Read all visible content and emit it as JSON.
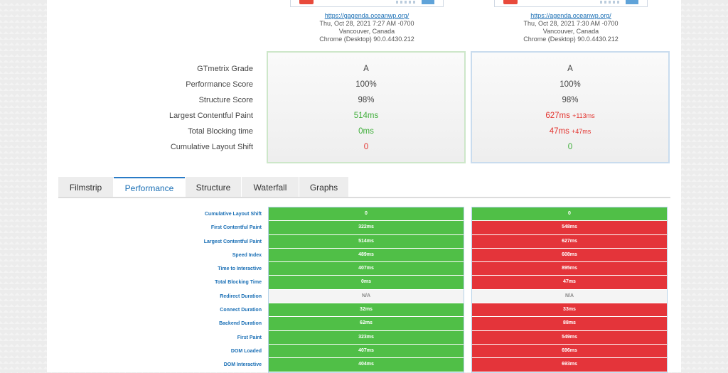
{
  "sites": [
    {
      "url": "https://gagenda.oceanwp.org/",
      "date": "Thu, Oct 28, 2021 7:27 AM -0700",
      "location": "Vancouver, Canada",
      "browser": "Chrome (Desktop) 90.0.4430.212"
    },
    {
      "url": "https://agenda.oceanwp.org/",
      "date": "Thu, Oct 28, 2021 7:30 AM -0700",
      "location": "Vancouver, Canada",
      "browser": "Chrome (Desktop) 90.0.4430.212"
    }
  ],
  "summary": {
    "labels": [
      "GTmetrix Grade",
      "Performance Score",
      "Structure Score",
      "Largest Contentful Paint",
      "Total Blocking time",
      "Cumulative Layout Shift"
    ],
    "a": [
      "A",
      "100%",
      "98%",
      "514ms",
      "0ms",
      "0"
    ],
    "b": [
      "A",
      "100%",
      "98%",
      "627ms",
      "47ms",
      "0"
    ],
    "b_delta": [
      "",
      "",
      "",
      "+113ms",
      "+47ms",
      ""
    ]
  },
  "tabs": [
    "Filmstrip",
    "Performance",
    "Structure",
    "Waterfall",
    "Graphs"
  ],
  "active_tab": "Performance",
  "metrics": {
    "labels": [
      "Cumulative Layout Shift",
      "First Contentful Paint",
      "Largest Contentful Paint",
      "Speed Index",
      "Time to Interactive",
      "Total Blocking Time",
      "Redirect Duration",
      "Connect Duration",
      "Backend Duration",
      "First Paint",
      "DOM Loaded",
      "DOM Interactive"
    ],
    "a": [
      "0",
      "322ms",
      "514ms",
      "489ms",
      "407ms",
      "0ms",
      "N/A",
      "32ms",
      "62ms",
      "323ms",
      "407ms",
      "404ms"
    ],
    "b": [
      "0",
      "548ms",
      "627ms",
      "608ms",
      "895ms",
      "47ms",
      "N/A",
      "33ms",
      "88ms",
      "549ms",
      "696ms",
      "693ms"
    ],
    "a_status": [
      "good",
      "good",
      "good",
      "good",
      "good",
      "good",
      "na",
      "good",
      "good",
      "good",
      "good",
      "good"
    ],
    "b_status": [
      "good",
      "bad",
      "bad",
      "bad",
      "bad",
      "bad",
      "na",
      "bad",
      "bad",
      "bad",
      "bad",
      "bad"
    ]
  },
  "colors": {
    "good": "#50bf47",
    "bad": "#e4343a",
    "accent": "#2a7bc6"
  }
}
